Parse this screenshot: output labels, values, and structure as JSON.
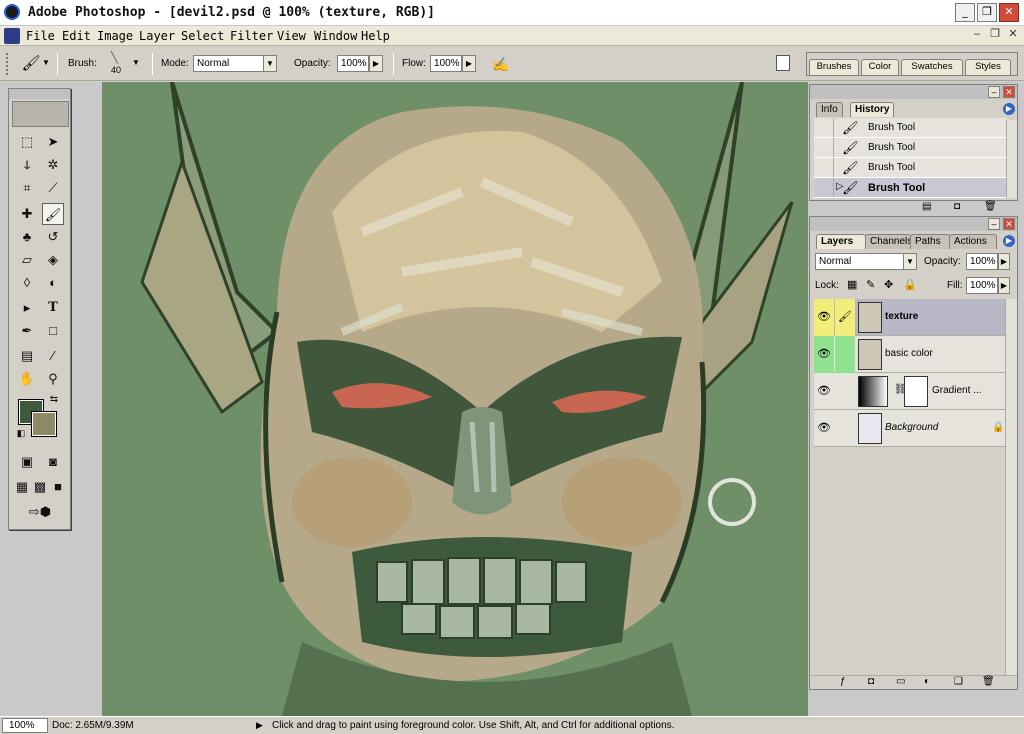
{
  "window": {
    "title": "Adobe Photoshop - [devil2.psd @ 100% (texture, RGB)]",
    "minimize": "_",
    "maximize": "❐",
    "close": "✕"
  },
  "menu": [
    "File",
    "Edit",
    "Image",
    "Layer",
    "Select",
    "Filter",
    "View",
    "Window",
    "Help"
  ],
  "options": {
    "brush_label": "Brush:",
    "brush_size": "40",
    "mode_label": "Mode:",
    "mode_value": "Normal",
    "opacity_label": "Opacity:",
    "opacity_value": "100%",
    "flow_label": "Flow:",
    "flow_value": "100%"
  },
  "palette_well": [
    "Brushes",
    "Color",
    "Swatches",
    "Styles"
  ],
  "history_panel": {
    "tabs": [
      "Info",
      "History"
    ],
    "rows": [
      {
        "label": "Brush Tool",
        "current": false
      },
      {
        "label": "Brush Tool",
        "current": false
      },
      {
        "label": "Brush Tool",
        "current": false
      },
      {
        "label": "Brush Tool",
        "current": true
      }
    ]
  },
  "layers_panel": {
    "tabs": [
      "Layers",
      "Channels",
      "Paths",
      "Actions"
    ],
    "blend_mode": "Normal",
    "opacity_label": "Opacity:",
    "opacity_value": "100%",
    "lock_label": "Lock:",
    "fill_label": "Fill:",
    "fill_value": "100%",
    "layers": [
      {
        "name": "texture",
        "active": true
      },
      {
        "name": "basic color",
        "active": false
      },
      {
        "name": "Gradient ...",
        "active": false
      },
      {
        "name": "Background",
        "active": false
      }
    ]
  },
  "status": {
    "zoom": "100%",
    "doc": "Doc: 2.65M/9.39M",
    "hint": "Click and drag to paint using foreground color.  Use Shift, Alt, and Ctrl for additional options."
  },
  "colors": {
    "foreground": "#3e5a3c",
    "background": "#8e8a66",
    "canvas_bg": "#6f8f68"
  }
}
